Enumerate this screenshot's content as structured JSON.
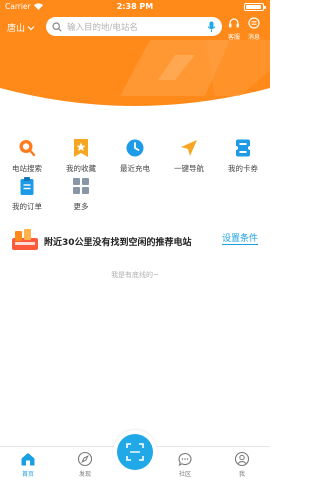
{
  "status_bar": {
    "carrier": "Carrier",
    "time": "2:38 PM"
  },
  "header": {
    "city": "唐山",
    "search_placeholder": "输入目的地/电站名",
    "service_label": "客服",
    "message_label": "消息",
    "brand_color": "#ff8a1a"
  },
  "grid": {
    "items": [
      {
        "label": "电站搜索",
        "icon": "search-location-icon"
      },
      {
        "label": "我的收藏",
        "icon": "star-bookmark-icon"
      },
      {
        "label": "最近充电",
        "icon": "clock-icon"
      },
      {
        "label": "一键导航",
        "icon": "navigation-arrow-icon"
      },
      {
        "label": "我的卡券",
        "icon": "coupon-icon"
      },
      {
        "label": "我的订单",
        "icon": "clipboard-order-icon"
      },
      {
        "label": "更多",
        "icon": "grid-more-icon"
      }
    ]
  },
  "notice": {
    "message": "附近30公里没有找到空闲的推荐电站",
    "settings_link": "设置条件"
  },
  "footer_text": "我是有底线的~",
  "tabbar": {
    "accent": "#21a8e6",
    "tabs": [
      {
        "label": "首页",
        "icon": "home-icon"
      },
      {
        "label": "发现",
        "icon": "compass-icon"
      },
      {
        "label": "社区",
        "icon": "chat-icon"
      },
      {
        "label": "我",
        "icon": "user-icon"
      }
    ],
    "center_icon": "scan-icon"
  }
}
